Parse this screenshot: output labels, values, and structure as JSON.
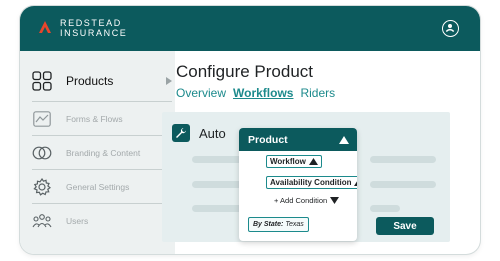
{
  "brand": {
    "line1": "REDSTEAD",
    "line2": "INSURANCE",
    "logo_icon": "chevron-logo-icon"
  },
  "header": {
    "account_icon": "user-account-icon"
  },
  "sidebar": {
    "items": [
      {
        "label": "Products",
        "icon": "grid-icon",
        "active": true
      },
      {
        "label": "Forms & Flows",
        "icon": "chart-line-icon",
        "active": false
      },
      {
        "label": "Branding & Content",
        "icon": "overlap-circles-icon",
        "active": false
      },
      {
        "label": "General Settings",
        "icon": "gear-icon",
        "active": false
      },
      {
        "label": "Users",
        "icon": "users-icon",
        "active": false
      }
    ]
  },
  "main": {
    "title": "Configure Product",
    "tabs": [
      {
        "label": "Overview",
        "active": false
      },
      {
        "label": "Workflows",
        "active": true
      },
      {
        "label": "Riders",
        "active": false
      }
    ],
    "card": {
      "label": "Auto",
      "icon": "wrench-icon"
    },
    "save_label": "Save"
  },
  "dropdown": {
    "header": "Product",
    "chips": [
      "Workflow",
      "Availability Condition"
    ],
    "add_condition": "+ Add Condition",
    "filter": {
      "key": "By State:",
      "value": "Texas"
    }
  },
  "colors": {
    "brand": "#0c5a5d",
    "accent": "#1c8a8c",
    "logo_red": "#e8452b"
  }
}
